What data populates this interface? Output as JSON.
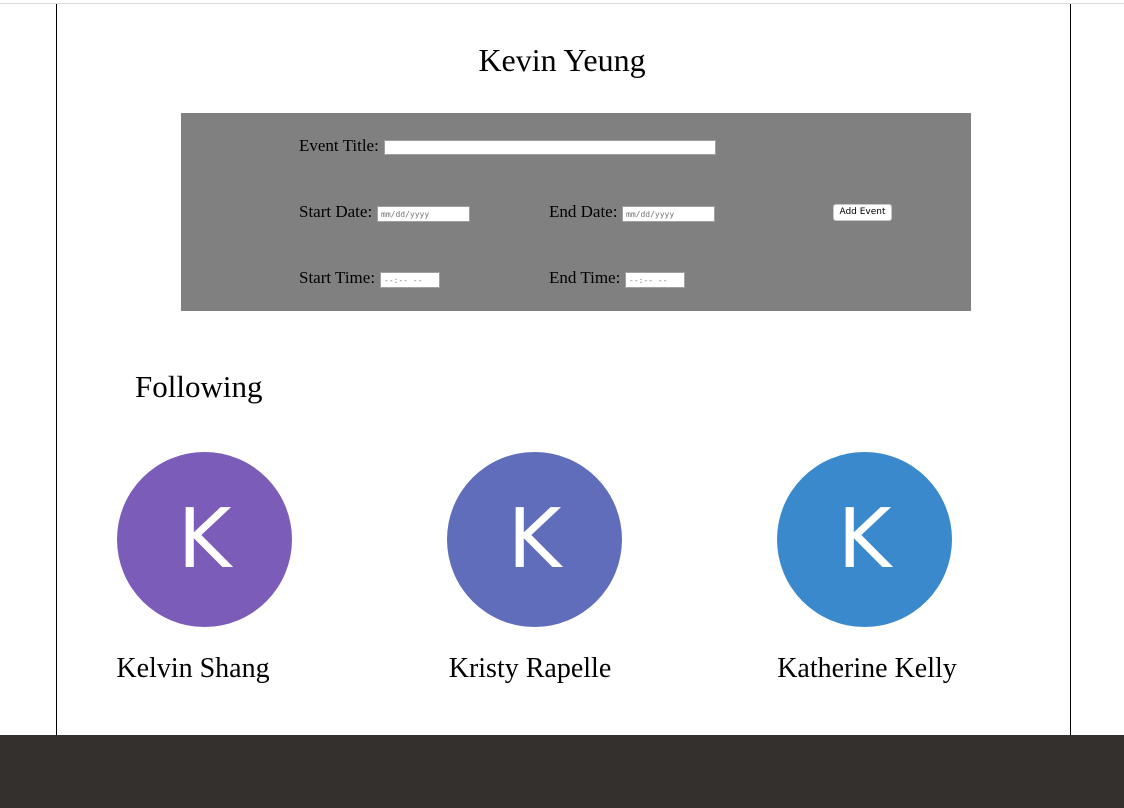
{
  "profile": {
    "name": "Kevin Yeung"
  },
  "event_form": {
    "title_label": "Event Title:",
    "title_value": "",
    "start_date_label": "Start Date:",
    "start_date_placeholder": "mm/dd/yyyy",
    "end_date_label": "End Date:",
    "end_date_placeholder": "mm/dd/yyyy",
    "start_time_label": "Start Time:",
    "start_time_placeholder": "--:-- --",
    "end_time_label": "End Time:",
    "end_time_placeholder": "--:-- --",
    "add_button": "Add Event"
  },
  "following": {
    "title": "Following",
    "people": [
      {
        "initial": "K",
        "name": "Kelvin Shang",
        "color": "#7b5cb8"
      },
      {
        "initial": "K",
        "name": "Kristy Rapelle",
        "color": "#5f6dba"
      },
      {
        "initial": "K",
        "name": "Katherine Kelly",
        "color": "#3a89cc"
      }
    ]
  },
  "colors": {
    "panel": "#808080",
    "footer": "#34302d"
  }
}
